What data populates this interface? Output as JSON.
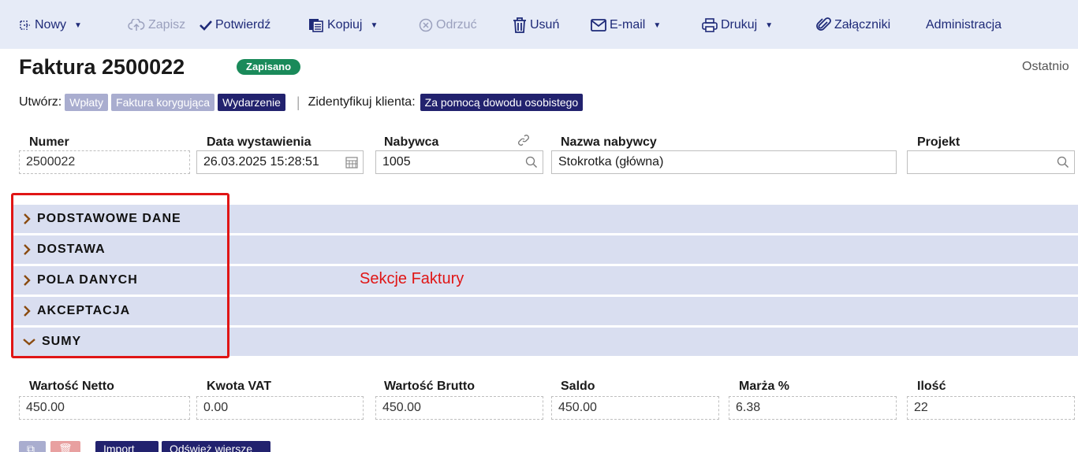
{
  "toolbar": {
    "new_label": "Nowy",
    "save_label": "Zapisz",
    "confirm_label": "Potwierdź",
    "copy_label": "Kopiuj",
    "discard_label": "Odrzuć",
    "delete_label": "Usuń",
    "email_label": "E-mail",
    "print_label": "Drukuj",
    "attachments_label": "Załączniki",
    "admin_label": "Administracja"
  },
  "header": {
    "title": "Faktura 2500022",
    "status_badge": "Zapisano",
    "last_label": "Ostatnio"
  },
  "create_row": {
    "label": "Utwórz:",
    "payments": "Wpłaty",
    "correction": "Faktura korygująca",
    "event": "Wydarzenie",
    "identify_label": "Zidentyfikuj klienta:",
    "identify_button": "Za pomocą dowodu osobistego"
  },
  "fields": {
    "number_label": "Numer",
    "number_value": "2500022",
    "date_label": "Data wystawienia",
    "date_value": "26.03.2025 15:28:51",
    "buyer_label": "Nabywca",
    "buyer_value": "1005",
    "buyer_name_label": "Nazwa nabywcy",
    "buyer_name_value": "Stokrotka (główna)",
    "project_label": "Projekt",
    "project_value": ""
  },
  "sections": [
    {
      "label": "PODSTAWOWE DANE",
      "expanded": false
    },
    {
      "label": "DOSTAWA",
      "expanded": false
    },
    {
      "label": "POLA DANYCH",
      "expanded": false
    },
    {
      "label": "AKCEPTACJA",
      "expanded": false
    },
    {
      "label": "SUMY",
      "expanded": true
    }
  ],
  "annotation": "Sekcje Faktury",
  "totals": {
    "net_label": "Wartość Netto",
    "net_value": "450.00",
    "vat_label": "Kwota VAT",
    "vat_value": "0.00",
    "gross_label": "Wartość Brutto",
    "gross_value": "450.00",
    "balance_label": "Saldo",
    "balance_value": "450.00",
    "margin_label": "Marża %",
    "margin_value": "6.38",
    "qty_label": "Ilość",
    "qty_value": "22"
  },
  "bottom": {
    "import_label": "Import",
    "refresh_label": "Odśwież wiersze"
  },
  "colors": {
    "toolbar_bg": "#e6ebf7",
    "accent_dark": "#22226e",
    "accent_light": "#a9adcf",
    "saved_green": "#1a8a5a",
    "section_bg": "#d9def0",
    "annotation_red": "#e01515"
  },
  "icons": {
    "new": "new-doc-icon",
    "save": "cloud-upload-icon",
    "confirm": "check-icon",
    "copy": "copy-icon",
    "discard": "circle-x-icon",
    "delete": "trash-icon",
    "email": "envelope-icon",
    "print": "printer-icon",
    "attachments": "paperclip-icon"
  }
}
